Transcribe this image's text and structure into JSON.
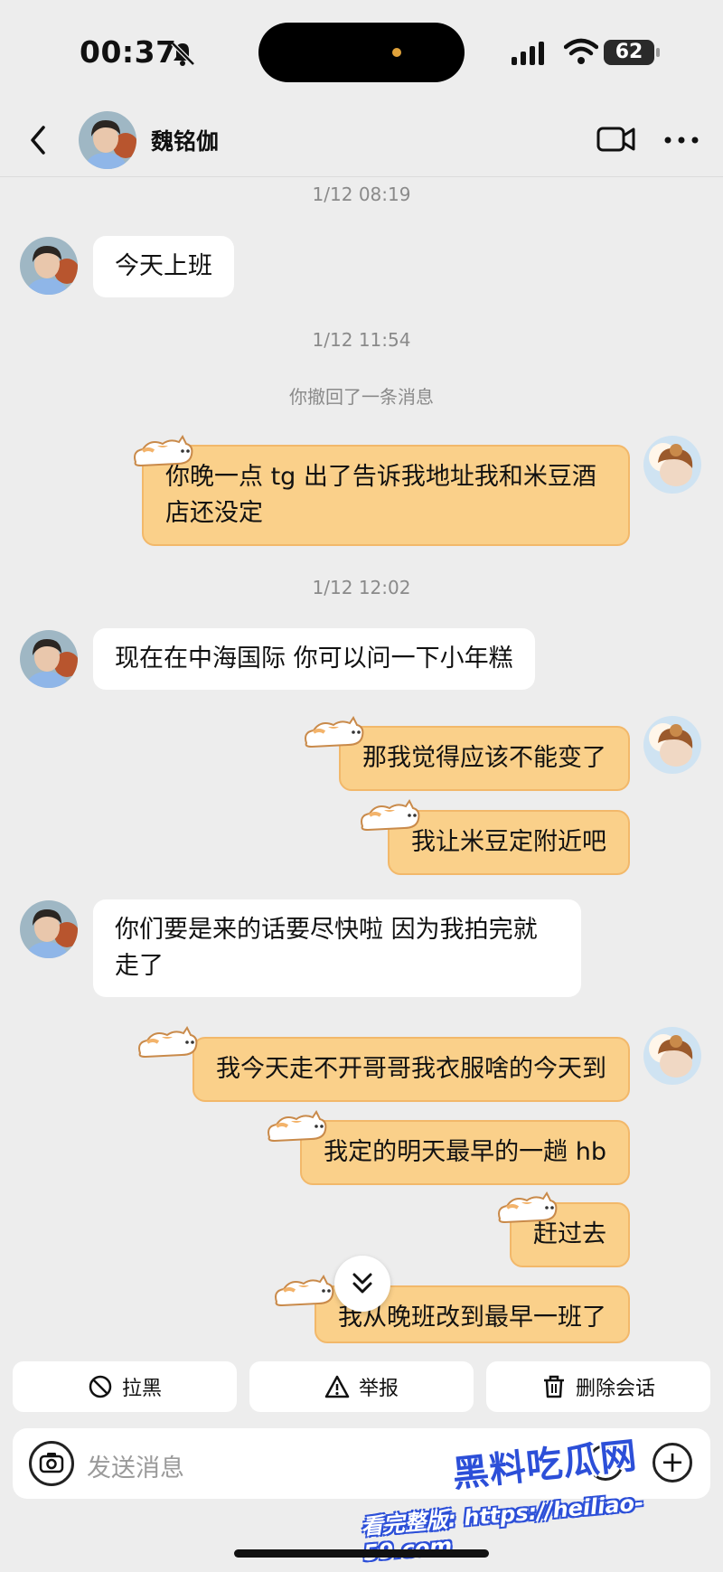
{
  "status_bar": {
    "time": "00:37",
    "battery": "62"
  },
  "header": {
    "contact_name": "魏铭伽"
  },
  "messages": {
    "ts1": "1/12 08:19",
    "m1": "今天上班",
    "ts2": "1/12 11:54",
    "recall_notice": "你撤回了一条消息",
    "m2": "你晚一点 tg 出了告诉我地址我和米豆酒店还没定",
    "ts3": "1/12 12:02",
    "m3": "现在在中海国际 你可以问一下小年糕",
    "m4": "那我觉得应该不能变了",
    "m5": "我让米豆定附近吧",
    "m6": "你们要是来的话要尽快啦 因为我拍完就走了",
    "m7": "我今天走不开哥哥我衣服啥的今天到",
    "m8": "我定的明天最早的一趟 hb",
    "m9": "赶过去",
    "m10": "我从晚班改到最早一班了"
  },
  "actions": {
    "block": "拉黑",
    "report": "举报",
    "delete": "删除会话"
  },
  "input": {
    "placeholder": "发送消息"
  },
  "watermark": {
    "logo": "黑料吃瓜网",
    "url": "看完整版: https://heiliao-59.com"
  },
  "icons": [
    "bell-off-icon",
    "signal-icon",
    "wifi-icon",
    "back-icon",
    "video-call-icon",
    "more-icon",
    "cat-sticker-icon",
    "chevron-double-down-icon",
    "block-icon",
    "warning-icon",
    "trash-icon",
    "camera-icon",
    "emoji-icon",
    "plus-icon"
  ],
  "colors": {
    "background": "#ededed",
    "outgoing_bubble": "#fad08a",
    "incoming_bubble": "#ffffff",
    "watermark": "#2c4fd8"
  }
}
